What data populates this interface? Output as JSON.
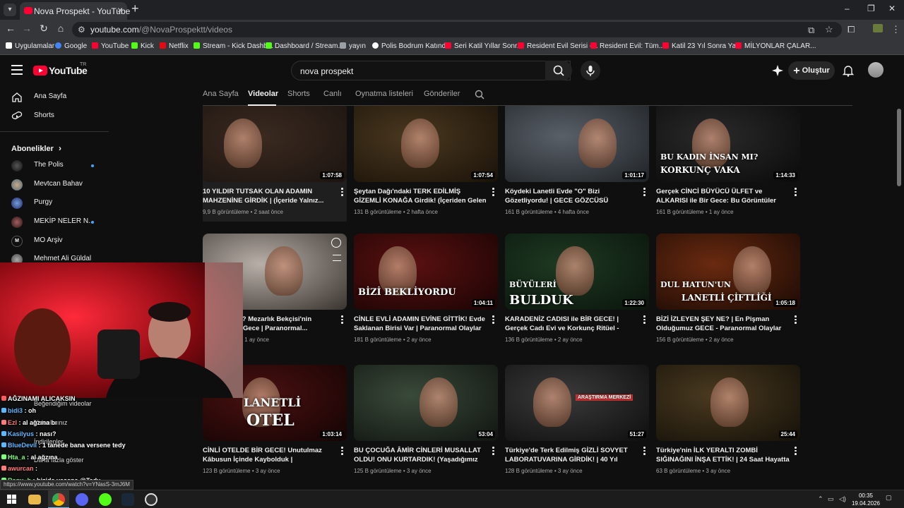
{
  "browser": {
    "tab_title": "Nova Prospekt - YouTube",
    "new_tab": "+",
    "url_host": "youtube.com",
    "url_path": "/@NovaProspektt/videos",
    "window_minimize": "–",
    "window_restore": "❐",
    "window_close": "✕",
    "bookmarks": [
      {
        "label": "Uygulamalar",
        "color": "#ffffff"
      },
      {
        "label": "Google",
        "color": "#4285f4"
      },
      {
        "label": "YouTube",
        "color": "#ff0033"
      },
      {
        "label": "Kick",
        "color": "#53fc18"
      },
      {
        "label": "Netflix",
        "color": "#e50914"
      },
      {
        "label": "Stream - Kick Dashb...",
        "color": "#53fc18"
      },
      {
        "label": "Dashboard / Stream...",
        "color": "#53fc18"
      },
      {
        "label": "yayın",
        "color": "#9aa0a6"
      },
      {
        "label": "Polis Bodrum Katınd...",
        "color": "#ffffff"
      },
      {
        "label": "Seri Katil Yıllar Sonr...",
        "color": "#ff0033"
      },
      {
        "label": "Resident Evil Serisi -...",
        "color": "#ff0033"
      },
      {
        "label": "Resident Evil: Tüm...",
        "color": "#ff0033"
      },
      {
        "label": "Katil 23 Yıl Sonra Ya...",
        "color": "#ff0033"
      },
      {
        "label": "MİLYONLAR ÇALAR...",
        "color": "#ff0033"
      }
    ]
  },
  "masthead": {
    "logo_text": "YouTube",
    "logo_tr": "TR",
    "search_value": "nova prospekt",
    "create_label": "Oluştur"
  },
  "sidebar": {
    "home": "Ana Sayfa",
    "shorts": "Shorts",
    "subscriptions_header": "Abonelikler",
    "channels": [
      {
        "name": "The Polis",
        "live": true,
        "color": "#222222"
      },
      {
        "name": "Mevtcan Bahav",
        "live": false,
        "color": "#6a8fa3"
      },
      {
        "name": "Purgy",
        "live": false,
        "color": "#3a5ea8"
      },
      {
        "name": "MEKİP NELER N...",
        "live": true,
        "color": "#553333"
      },
      {
        "name": "MO Arşiv",
        "live": false,
        "color": "#0f0f0f"
      },
      {
        "name": "Mehmet Ali Güldal",
        "live": false,
        "color": "#777777"
      }
    ],
    "under_overlay": [
      "Beğendiğim videolar",
      "Videolarınız",
      "İndirilenler",
      "Daha fazla göster"
    ]
  },
  "channel_tabs": [
    "Ana Sayfa",
    "Videolar",
    "Shorts",
    "Canlı",
    "Oynatma listeleri",
    "Gönderiler"
  ],
  "active_tab": "Videolar",
  "videos": [
    {
      "title": "10 YILDIR TUTSAK OLAN ADAMIN MAHZENİNE GİRDİK | (İçeride Yalnız...",
      "views": "9,9 B görüntüleme",
      "age": "2 saat önce",
      "duration": "1:07:58",
      "overlay": "",
      "c1": "#3a2a20",
      "c2": "#1c1410"
    },
    {
      "title": "Şeytan Dağı'ndaki TERK EDİLMİŞ GİZEMLİ KONAĞA Girdik! (İçeriden Gelen Korkunç...",
      "views": "131 B görüntüleme",
      "age": "2 hafta önce",
      "duration": "1:07:54",
      "overlay": "",
      "c1": "#4a3820",
      "c2": "#1a1208"
    },
    {
      "title": "Köydeki Lanetli Evde \"O\" Bizi Gözetliyordu! | GECE GÖZCÜSÜ VAKASINDA BİR GECE",
      "views": "161 B görüntüleme",
      "age": "4 hafta önce",
      "duration": "1:01:17",
      "overlay": "",
      "c1": "#5a6068",
      "c2": "#1e2226"
    },
    {
      "title": "Gerçek CİNCİ BÜYÜCÜ ÜLFET ve ALKARISI ile Bir Gece: Bu Görüntüler İnternetten...",
      "views": "161 B görüntüleme",
      "age": "1 ay önce",
      "duration": "1:14:33",
      "overlay": "BU KADIN İNSAN MI?",
      "overlay2": "KORKUNÇ VAKA",
      "c1": "#2a2a2a",
      "c2": "#0a0a0a"
    },
    {
      "title": "ÇOK ŞEY Mİ? Mezarlık Bekçisi'nin Korkunç Bir Gece | Paranormal...",
      "views": "B görüntüleme",
      "age": "1 ay önce",
      "duration": "",
      "overlay": "",
      "c1": "#b8b0a8",
      "c2": "#3a3430"
    },
    {
      "title": "CİNLE EVLİ ADAMIN EVİNE GİTTİK! Evde Saklanan Birisi Var | Paranormal Olaylar",
      "views": "181 B görüntüleme",
      "age": "2 ay önce",
      "duration": "1:04:11",
      "overlay": "BİZİ BEKLİYORDU",
      "c1": "#5a1010",
      "c2": "#1a0404"
    },
    {
      "title": "KARADENİZ CADISI ile BİR GECE! | Gerçek Cadı Evi ve Korkunç Ritüel - Paranormal...",
      "views": "136 B görüntüleme",
      "age": "2 ay önce",
      "duration": "1:22:30",
      "overlay": "BÜYÜLERİ",
      "overlay2": "BULDUK",
      "c1": "#1e3a22",
      "c2": "#0a140c"
    },
    {
      "title": "BİZİ İZLEYEN ŞEY NE? | En Pişman Olduğumuz GECE - Paranormal Olaylar",
      "views": "156 B görüntüleme",
      "age": "2 ay önce",
      "duration": "1:05:18",
      "overlay": "DUL HATUN'UN",
      "overlay2": "LANETLİ ÇİFTLİĞİ",
      "c1": "#6a2a10",
      "c2": "#1a0a04"
    },
    {
      "title": "CİNLİ OTELDE BİR GECE! Unutulmaz Kâbusun İçinde Kaybolduk | Paranormal...",
      "views": "123 B görüntüleme",
      "age": "3 ay önce",
      "duration": "1:03:14",
      "overlay": "LANETLİ",
      "overlay2": "OTEL",
      "c1": "#4a1010",
      "c2": "#140404"
    },
    {
      "title": "BU ÇOCUĞA ÂMİR CİNLERİ MUSALLAT OLDU! ONU KURTARDIK! (Yaşadığımız En...",
      "views": "125 B görüntüleme",
      "age": "3 ay önce",
      "duration": "53:04",
      "overlay": "",
      "c1": "#3a4a3a",
      "c2": "#101410"
    },
    {
      "title": "Türkiye'de Terk Edilmiş GİZLİ SOVYET LABORATUVARINA GİRDİK! | 40 Yıl Sonra...",
      "views": "128 B görüntüleme",
      "age": "3 ay önce",
      "duration": "51:27",
      "overlay": "ARAŞTIRMA MERKEZİ",
      "c1": "#3a3a3a",
      "c2": "#0e0e0e"
    },
    {
      "title": "Türkiye'nin İLK YERALTI ZOMBİ SIĞINAĞINI İNŞA ETTİK! | 24 Saat Hayatta Kalma",
      "views": "63 B görüntüleme",
      "age": "3 ay önce",
      "duration": "25:44",
      "overlay": "",
      "c1": "#4a3a20",
      "c2": "#141008"
    }
  ],
  "chat": [
    {
      "user": "",
      "text": "AĞZINAMI ALICAKSIN",
      "color": "#ff5c5c"
    },
    {
      "user": "bidi3",
      "text": "oh",
      "color": "#5cb8ff"
    },
    {
      "user": "Ezl",
      "text": "al ağzına bı",
      "color": "#ff7a7a"
    },
    {
      "user": "Kasilyus",
      "text": "nası?",
      "color": "#5cb8ff"
    },
    {
      "user": "BlueDevil",
      "text": "1 tanede bana versene tedy",
      "color": "#5cb8ff"
    },
    {
      "user": "Hta_a",
      "text": "al ağzına",
      "color": "#7cff7c"
    },
    {
      "user": "awurcan",
      "text": "",
      "color": "#ff7a7a"
    },
    {
      "user": "Regu_b",
      "text": "bizide yesene @Tedy",
      "color": "#7cff7c"
    }
  ],
  "status_url": "https://www.youtube.com/watch?v=YNasS-3mJ6M",
  "taskbar": {
    "time": "00:35",
    "date": "19.04.2026"
  }
}
